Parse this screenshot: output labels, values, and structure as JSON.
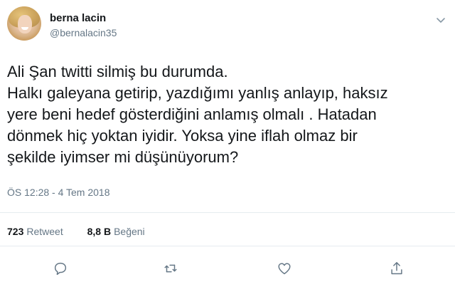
{
  "user": {
    "display_name": "berna lacin",
    "handle": "@bernalacin35"
  },
  "tweet": {
    "text": "Ali Şan twitti silmiş bu durumda.\nHalkı galeyana getirip, yazdığımı yanlış anlayıp, haksız\nyere beni hedef gösterdiğini anlamış olmalı . Hatadan\ndönmek hiç yoktan iyidir. Yoksa yine iflah olmaz bir\nşekilde iyimser mi düşünüyorum?",
    "timestamp": "ÖS 12:28 - 4 Tem 2018"
  },
  "stats": {
    "retweets_count": "723",
    "retweets_label": "Retweet",
    "likes_count": "8,8 B",
    "likes_label": "Beğeni"
  },
  "icons": {
    "menu": "chevron-down-icon",
    "reply": "reply-icon",
    "retweet": "retweet-icon",
    "like": "heart-icon",
    "share": "share-icon"
  },
  "colors": {
    "text_primary": "#14171a",
    "text_secondary": "#657786",
    "divider": "#e6ecf0",
    "icon": "#657786"
  }
}
